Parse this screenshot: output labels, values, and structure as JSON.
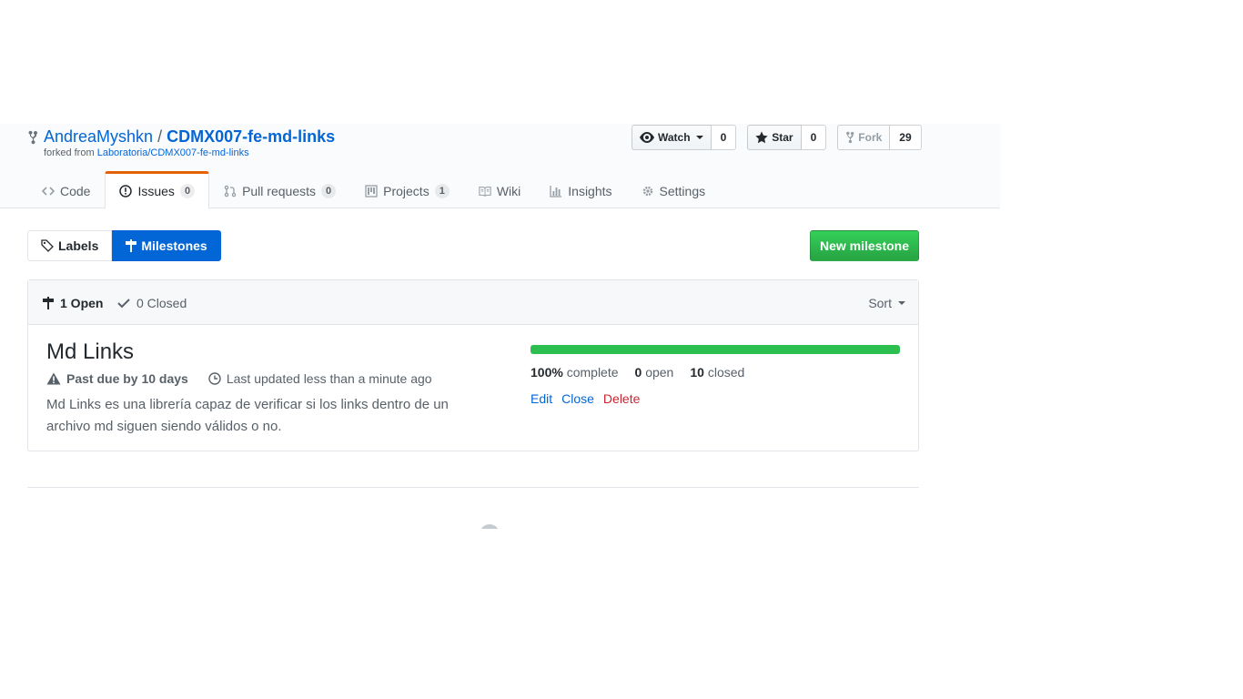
{
  "repo": {
    "owner": "AndreaMyshkn",
    "separator": "/",
    "name": "CDMX007-fe-md-links",
    "forked_from_prefix": "forked from",
    "forked_from": "Laboratoria/CDMX007-fe-md-links"
  },
  "actions": {
    "watch_label": "Watch",
    "watch_count": "0",
    "star_label": "Star",
    "star_count": "0",
    "fork_label": "Fork",
    "fork_count": "29"
  },
  "reponav": {
    "code": "Code",
    "issues": "Issues",
    "issues_count": "0",
    "pulls": "Pull requests",
    "pulls_count": "0",
    "projects": "Projects",
    "projects_count": "1",
    "wiki": "Wiki",
    "insights": "Insights",
    "settings": "Settings"
  },
  "subnav": {
    "labels": "Labels",
    "milestones": "Milestones",
    "new_milestone": "New milestone"
  },
  "filters": {
    "open": "1 Open",
    "closed": "0 Closed",
    "sort": "Sort"
  },
  "milestone": {
    "title": "Md Links",
    "past_due": "Past due by 10 days",
    "updated": "Last updated less than a minute ago",
    "description": "Md Links es una librería capaz de verificar si los links dentro de un archivo md siguen siendo válidos o no.",
    "progress_percent": 100,
    "percent_value": "100%",
    "percent_label": "complete",
    "open_count": "0",
    "open_label": "open",
    "closed_count": "10",
    "closed_label": "closed",
    "edit": "Edit",
    "close": "Close",
    "delete": "Delete"
  },
  "colors": {
    "link": "#0366d6",
    "accent_tab": "#e36209",
    "primary_green": "#28a745",
    "progress_green": "#2cbe4e",
    "danger": "#cb2431",
    "selected_blue": "#0366d6"
  }
}
